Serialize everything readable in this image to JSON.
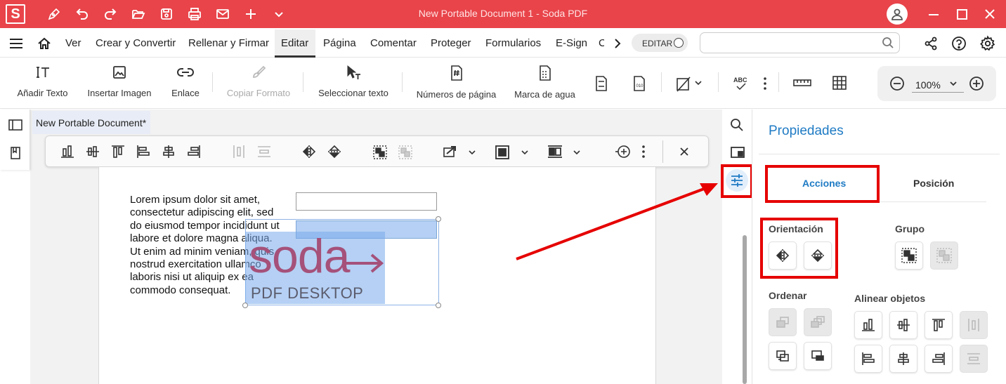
{
  "window": {
    "title": "New Portable Document 1   -   Soda PDF",
    "app_logo": "S"
  },
  "menu": {
    "items": [
      "Ver",
      "Crear y Convertir",
      "Rellenar y Firmar",
      "Editar",
      "Página",
      "Comentar",
      "Proteger",
      "Formularios",
      "E-Sign",
      "C"
    ],
    "active": "Editar",
    "editar_toggle": "EDITAR"
  },
  "ribbon": {
    "add_text": "Añadir Texto",
    "insert_image": "Insertar Imagen",
    "link": "Enlace",
    "copy_format": "Copiar Formato",
    "select_text": "Seleccionar texto",
    "page_numbers": "Números de página",
    "watermark": "Marca de agua",
    "zoom": "100%"
  },
  "document": {
    "tab": "New Portable Document*",
    "text_lines": [
      "Lorem ipsum dolor sit amet,",
      "consectetur adipiscing elit, sed",
      "do eiusmod tempor incididunt ut",
      "labore et dolore magna aliqua.",
      "Ut enim ad minim veniam, quis",
      "nostrud exercitation ullamco",
      "laboris nisi ut aliquip ex ea",
      "commodo consequat."
    ],
    "logo_word": "soda",
    "logo_sub": "PDF DESKTOP"
  },
  "properties": {
    "title": "Propiedades",
    "tabs": [
      "Acciones",
      "Posición"
    ],
    "active_tab": "Acciones",
    "orientation": "Orientación",
    "group": "Grupo",
    "order": "Ordenar",
    "align": "Alinear objetos"
  },
  "colors": {
    "brand": "#e8444a",
    "accent": "#1f7bc4",
    "highlight": "#e60000"
  }
}
